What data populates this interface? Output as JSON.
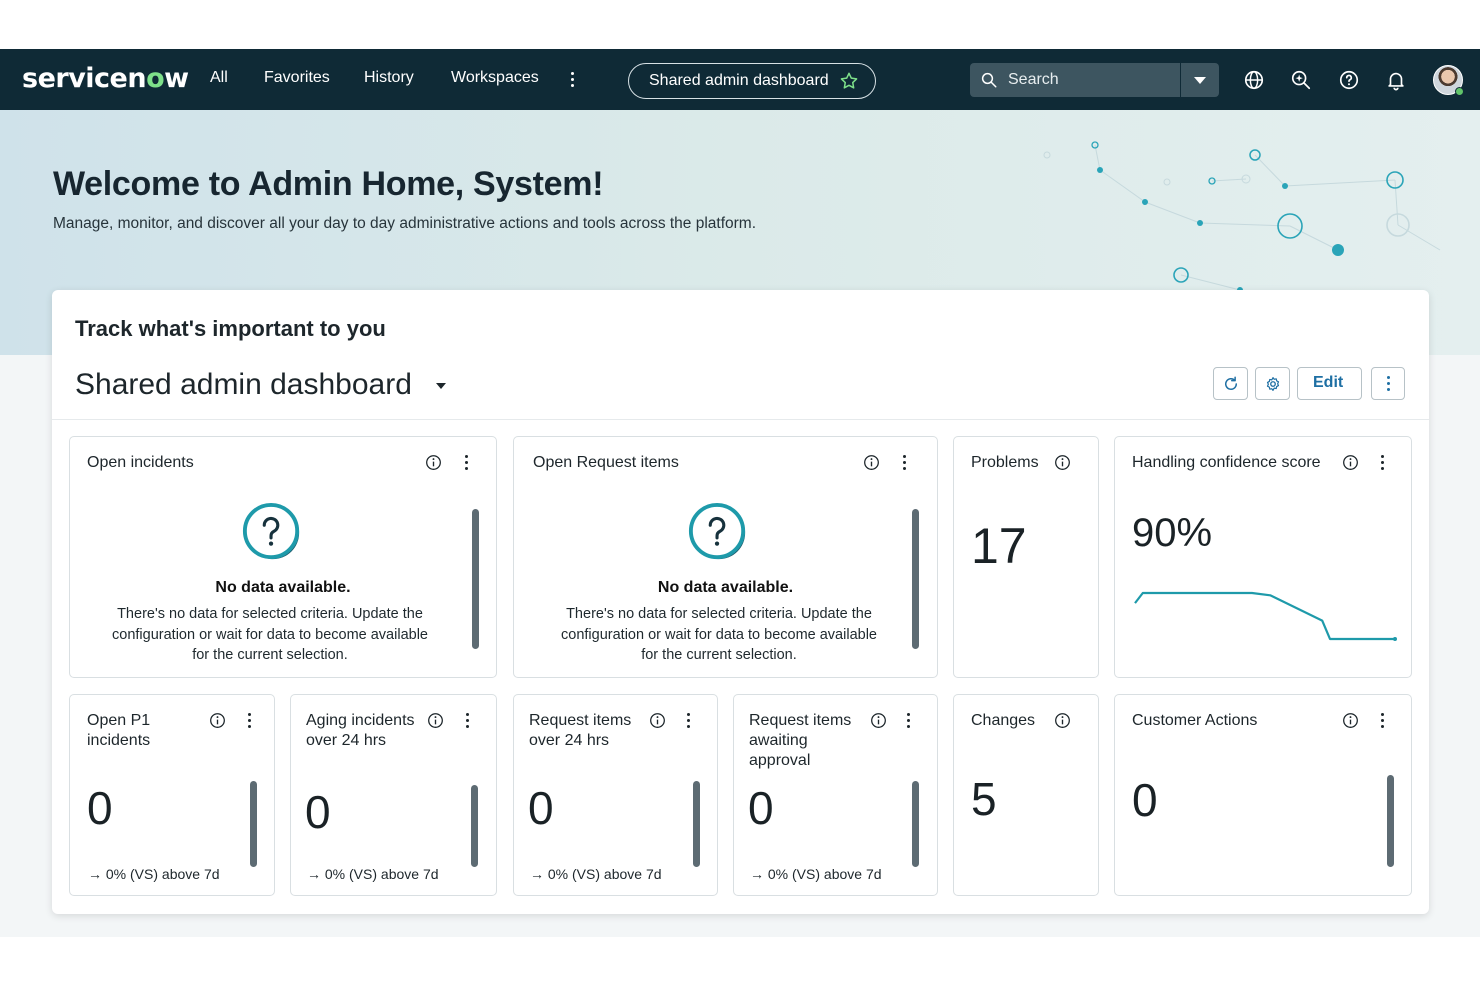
{
  "nav": {
    "logo": "servicenow",
    "links": [
      "All",
      "Favorites",
      "History",
      "Workspaces"
    ],
    "context_pill": "Shared admin dashboard",
    "search_placeholder": "Search"
  },
  "hero": {
    "title": "Welcome to Admin Home, System!",
    "subtitle": "Manage, monitor, and discover all your day to day administrative actions and tools across the platform."
  },
  "dashboard": {
    "track_heading": "Track what's important to you",
    "title": "Shared admin dashboard",
    "edit_label": "Edit"
  },
  "widgets": {
    "open_incidents": {
      "title": "Open incidents",
      "nodata_title": "No data available.",
      "nodata_desc": "There's no data for selected criteria. Update the configuration or wait for data to become available for the current selection."
    },
    "open_request_items": {
      "title": "Open Request items",
      "nodata_title": "No data available.",
      "nodata_desc": "There's no data for selected criteria. Update the configuration or wait for data to become available for the current selection."
    },
    "problems": {
      "title": "Problems",
      "value": "17"
    },
    "handling_confidence": {
      "title": "Handling confidence score",
      "value": "90%",
      "trend_points": [
        0.78,
        1.0,
        1.0,
        1.0,
        0.95,
        0.4,
        0.0,
        0.0,
        0.0
      ]
    },
    "open_p1": {
      "title": "Open P1 incidents",
      "value": "0",
      "trend": "→ 0% (VS) above 7d"
    },
    "aging": {
      "title": "Aging incidents over 24 hrs",
      "value": "0",
      "trend": "→ 0% (VS) above 7d"
    },
    "req_over_24": {
      "title": "Request items over 24 hrs",
      "value": "0",
      "trend": "→ 0% (VS) above 7d"
    },
    "req_awaiting": {
      "title": "Request items awaiting approval",
      "value": "0",
      "trend": "→ 0% (VS) above 7d"
    },
    "changes": {
      "title": "Changes",
      "value": "5"
    },
    "customer_actions": {
      "title": "Customer Actions",
      "value": "0"
    }
  },
  "colors": {
    "nav_bg": "#0f2a36",
    "accent": "#1e9aaa",
    "link_blue": "#1e6fa3"
  },
  "icons": [
    "search-icon",
    "star-icon",
    "globe-icon",
    "sparkle-search-icon",
    "help-icon",
    "bell-icon",
    "refresh-icon",
    "gear-icon",
    "info-icon",
    "question-icon",
    "kebab-icon"
  ]
}
